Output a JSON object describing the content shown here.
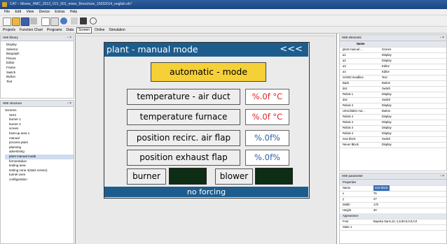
{
  "window": {
    "title": "CAT – Mixme_HMC_2013_V21_001_mixer_Broschüre_15032014_english.xfc*"
  },
  "menu": [
    "File",
    "Edit",
    "View",
    "Device",
    "Extras",
    "Help"
  ],
  "tabs": [
    {
      "label": "Projects",
      "active": false
    },
    {
      "label": "Function Chart",
      "active": false
    },
    {
      "label": "Programs",
      "active": false
    },
    {
      "label": "Data",
      "active": false
    },
    {
      "label": "Screen",
      "active": true
    },
    {
      "label": "Online",
      "active": false
    },
    {
      "label": "Simulation",
      "active": false
    }
  ],
  "library": {
    "title": "HMI library",
    "items": [
      "Display",
      "Selector",
      "Bargraph",
      "Picture",
      "Editor",
      "Frame",
      "Switch",
      "Button",
      "Text"
    ]
  },
  "structure": {
    "title": "HMI structure",
    "items": [
      "Screens",
      "SHI4",
      "burner 1",
      "burner 2",
      "screen",
      "heat-up area 1",
      "manual",
      "process plant",
      "planning",
      "advertising",
      "plant manual mode",
      "fermentation",
      "testing area",
      "testing zone 4(start screen)",
      "tunnel oven",
      "configuration"
    ],
    "selected": "plant manual mode"
  },
  "hmi": {
    "title": "plant - manual mode",
    "back": "<<<",
    "auto_button": "automatic - mode",
    "rows": [
      {
        "label": "temperature - air duct",
        "value": "%.0f °C"
      },
      {
        "label": "temperature furnace",
        "value": "%.0f °C"
      },
      {
        "label": "position recirc. air flap",
        "value": "%.0f%"
      },
      {
        "label": "position exhaust flap",
        "value": "%.0f%"
      }
    ],
    "burner": "burner",
    "blower": "blower",
    "footer": "no forcing"
  },
  "elements": {
    "title": "HMI elements",
    "header": "Name",
    "rows": [
      [
        "plant manual ...",
        "Screen"
      ],
      [
        "a1",
        "Display"
      ],
      [
        "a2",
        "Display"
      ],
      [
        "a3",
        "Editor"
      ],
      [
        "a4",
        "Editor"
      ],
      [
        "SHOD Headline",
        "Text"
      ],
      [
        "Back",
        "Button"
      ],
      [
        "ds1",
        "Switch"
      ],
      [
        "Relais 1",
        "Display"
      ],
      [
        "ds2",
        "Switch"
      ],
      [
        "Relais 4",
        "Display"
      ],
      [
        "Umschalter Aut...",
        "Button"
      ],
      [
        "Relais 4",
        "Display"
      ],
      [
        "Relais 4",
        "Display"
      ],
      [
        "Relais 4",
        "Display"
      ],
      [
        "Relais 4",
        "Display"
      ],
      [
        "new block",
        "Switch"
      ],
      [
        "Neuer Block",
        "Display"
      ]
    ]
  },
  "parameter": {
    "title": "HMI parameter",
    "properties_label": "Properties",
    "rows": [
      [
        "Name",
        "new block",
        "sel"
      ],
      [
        "x",
        "75",
        ""
      ],
      [
        "y",
        "27",
        ""
      ],
      [
        "Width",
        "170",
        ""
      ],
      [
        "Height",
        "30",
        ""
      ],
      [
        "Appearance",
        "",
        "group"
      ],
      [
        "Font",
        "Bayeka Sans,12,-1,5,90,0,0,0,0,0",
        ""
      ],
      [
        "State 1",
        "",
        ""
      ]
    ]
  },
  "colors": {
    "hmi_blue": "#1d5d8e",
    "auto_yellow": "#f5d037",
    "value_red": "#e02020",
    "value_blue": "#2c5f9e",
    "indicator_dark": "#0d2d14"
  }
}
